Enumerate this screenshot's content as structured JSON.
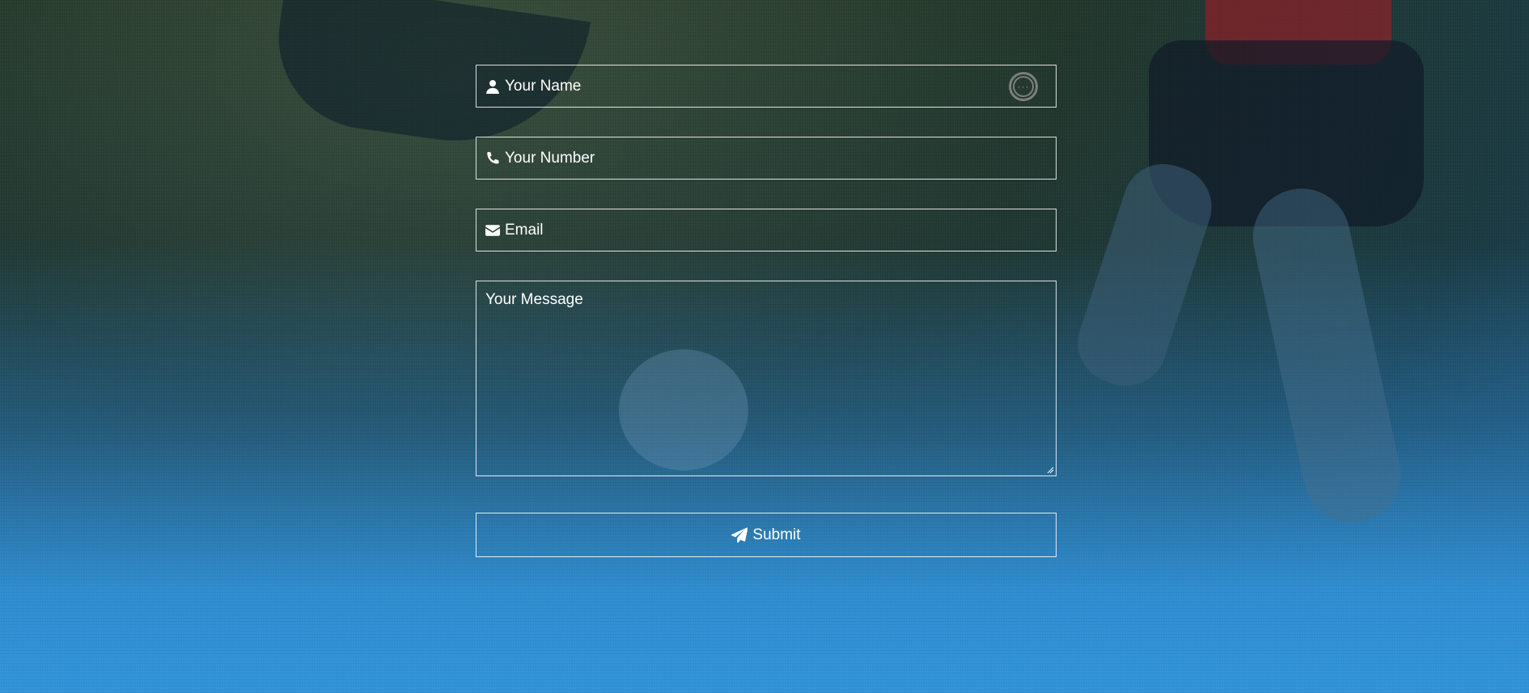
{
  "form": {
    "name_placeholder": "Your Name",
    "number_placeholder": "Your Number",
    "email_placeholder": "Email",
    "message_placeholder": "Your Message",
    "submit_label": "Submit",
    "icons": {
      "name": "user-icon",
      "number": "phone-icon",
      "email": "envelope-icon",
      "submit": "paper-plane-icon",
      "extension": "more-options-icon"
    },
    "extension_glyph": "···"
  },
  "colors": {
    "background_bottom": "#3194da",
    "border": "#ffffff",
    "text": "#ffffff"
  }
}
